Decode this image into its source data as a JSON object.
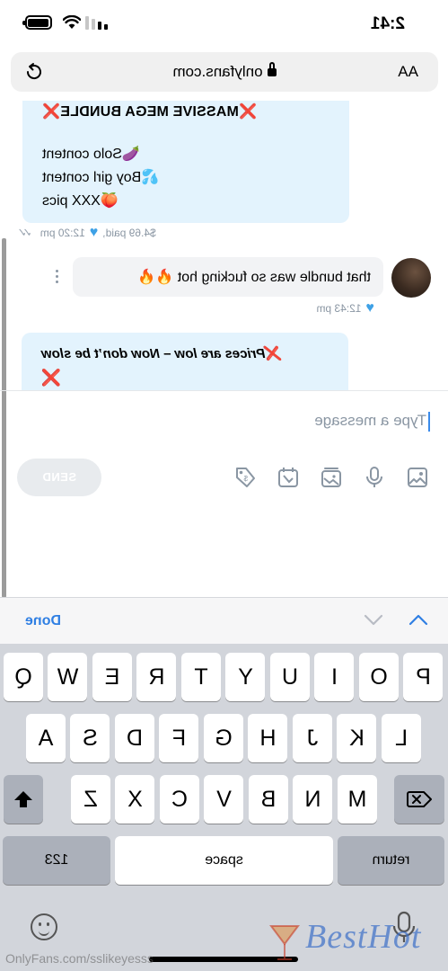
{
  "status_bar": {
    "time": "2:41"
  },
  "browser": {
    "text_size_label": "AA",
    "url": "onlyfans.com"
  },
  "messages": [
    {
      "lines": [
        "❌MASSIVE MEGA BUNDLE❌",
        "🍆Solo content",
        "💦Boy girl content",
        "🍑XXX pics"
      ],
      "price_label": "$4.69 paid,",
      "time": "12:20 pm"
    },
    {
      "text": "that bundle was so fucking hot 🔥🔥",
      "time": "12:43 pm"
    },
    {
      "text": "❌Prices are low – Now don’t be slow",
      "extra": "❌"
    }
  ],
  "composer": {
    "placeholder": "Type a message",
    "send_label": "SEND"
  },
  "accessory": {
    "done_label": "Done"
  },
  "keyboard": {
    "row1": [
      "Q",
      "W",
      "E",
      "R",
      "T",
      "Y",
      "U",
      "I",
      "O",
      "P"
    ],
    "row2": [
      "A",
      "S",
      "D",
      "F",
      "G",
      "H",
      "J",
      "K",
      "L"
    ],
    "row3": [
      "Z",
      "X",
      "C",
      "V",
      "B",
      "N",
      "M"
    ],
    "numbers_label": "123",
    "space_label": "space",
    "return_label": "return"
  },
  "watermarks": {
    "source": "OnlyFans.com/sslikeyesss",
    "brand": "BestHot"
  },
  "colors": {
    "bubble": "#e3f3fd",
    "accent": "#2f7fe3",
    "heart": "#3ea1e6",
    "keyboard_bg": "#d2d5db"
  }
}
